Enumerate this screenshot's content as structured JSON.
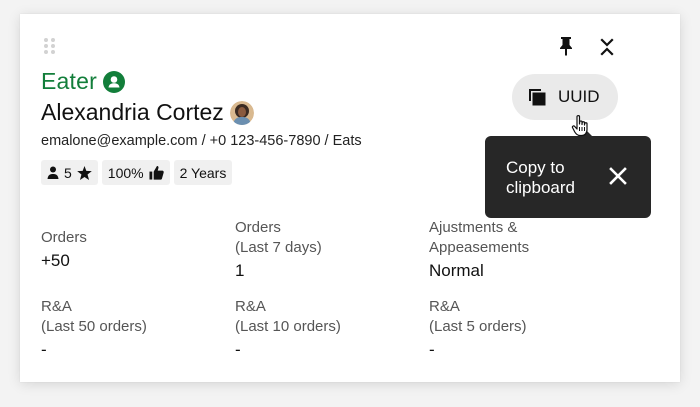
{
  "header": {
    "role": "Eater",
    "name": "Alexandria Cortez",
    "contact": "emalone@example.com / +0 123-456-7890 / Eats"
  },
  "chips": [
    {
      "value": "5",
      "icons": [
        "person-icon",
        "star-icon"
      ]
    },
    {
      "value": "100%",
      "icons": [
        "thumbs-up-icon"
      ]
    },
    {
      "value": "2 Years",
      "icons": []
    }
  ],
  "uuid_button": {
    "label": "UUID"
  },
  "tooltip": {
    "text": "Copy to clipboard"
  },
  "stats": [
    {
      "label_line1": "Orders",
      "label_line2": "",
      "value": "+50"
    },
    {
      "label_line1": "Orders",
      "label_line2": "(Last 7 days)",
      "value": "1"
    },
    {
      "label_line1": "Ajustments &",
      "label_line2": "Appeasements",
      "value": "Normal"
    },
    {
      "label_line1": "R&A",
      "label_line2": "(Last 50 orders)",
      "value": "-"
    },
    {
      "label_line1": "R&A",
      "label_line2": "(Last 10 orders)",
      "value": "-"
    },
    {
      "label_line1": "R&A",
      "label_line2": "(Last 5 orders)",
      "value": "-"
    }
  ],
  "colors": {
    "accent": "#127e3a",
    "tooltip_bg": "#272727",
    "chip_bg": "#f0f0f0"
  }
}
